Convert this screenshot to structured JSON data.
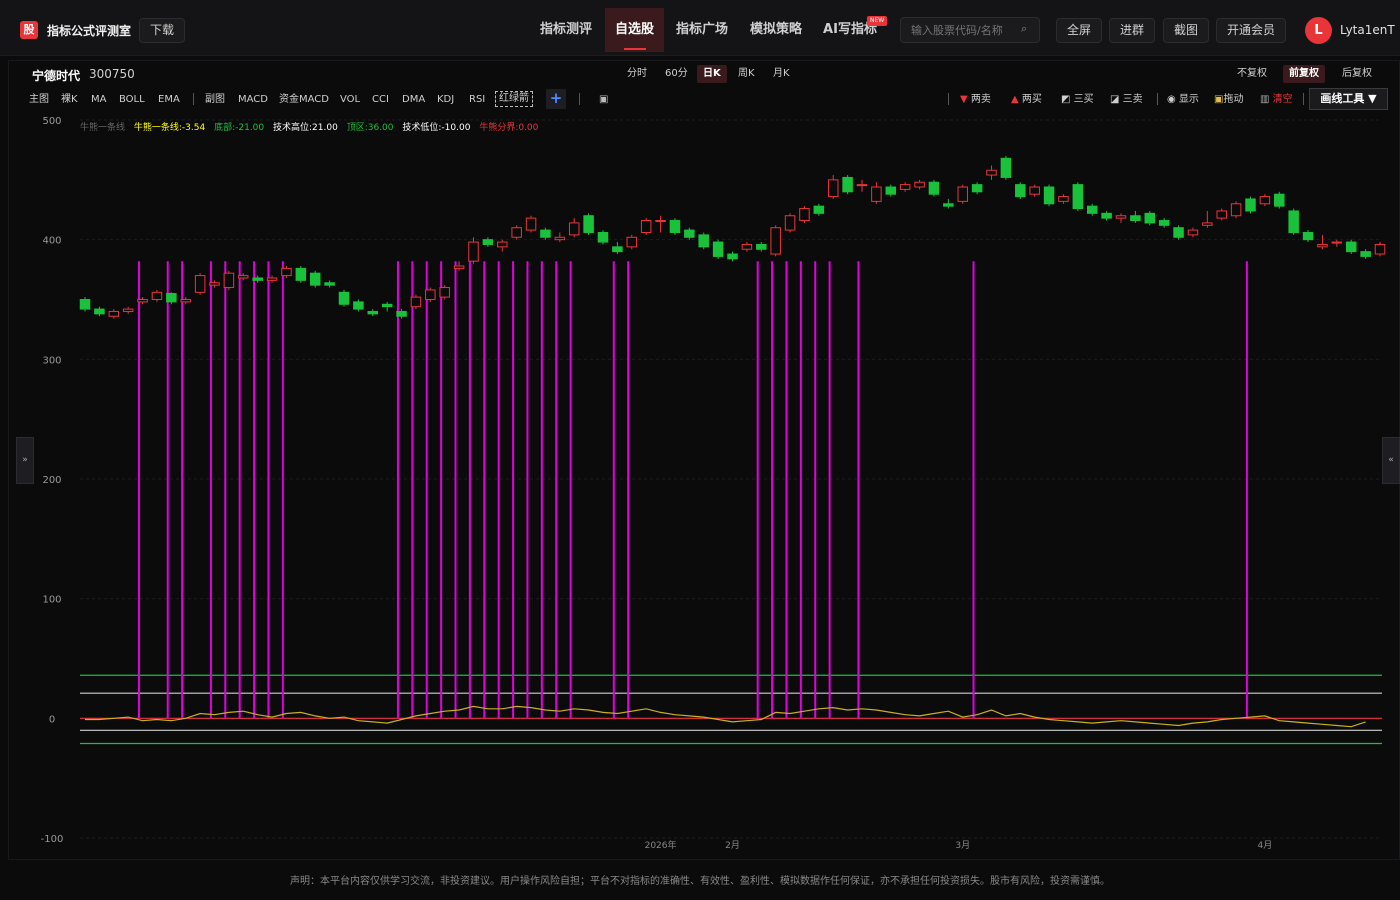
{
  "app": {
    "logo_char": "股",
    "title": "指标公式评测室",
    "download": "下载"
  },
  "nav": {
    "items": [
      "指标测评",
      "自选股",
      "指标广场",
      "模拟策略",
      "AI写指标"
    ],
    "active": "自选股",
    "new_badge": "NEW"
  },
  "search": {
    "placeholder": "输入股票代码/名称",
    "icon": "search-icon"
  },
  "top_buttons": [
    "全屏",
    "进群",
    "截图",
    "开通会员"
  ],
  "user": {
    "initial": "L",
    "name": "Lyta1enT"
  },
  "stock": {
    "name": "宁德时代",
    "code": "300750"
  },
  "periods": {
    "items": [
      "分时",
      "60分",
      "日K",
      "周K",
      "月K"
    ],
    "active": "日K"
  },
  "adjust": {
    "items": [
      "不复权",
      "前复权",
      "后复权"
    ],
    "active": "前复权"
  },
  "indicators": {
    "main_label": "主图",
    "main": [
      "裸K",
      "MA",
      "BOLL",
      "EMA"
    ],
    "sub_label": "副图",
    "sub": [
      "MACD",
      "资金MACD",
      "VOL",
      "CCI",
      "DMA",
      "KDJ",
      "RSI",
      "红绿箭"
    ],
    "selected": "红绿箭",
    "add": "+",
    "save_icon": "save-icon"
  },
  "tools": {
    "items": [
      {
        "icon": "▼",
        "label": "两卖",
        "color": "#e8353a"
      },
      {
        "icon": "▲",
        "label": "两买",
        "color": "#e8353a"
      },
      {
        "icon": "◩",
        "label": "三买",
        "color": "#cfcfcf"
      },
      {
        "icon": "◪",
        "label": "三卖",
        "color": "#cfcfcf"
      },
      {
        "icon": "◉",
        "label": "显示",
        "color": "#cfcfcf"
      },
      {
        "icon": "🔒",
        "label": "拖动",
        "color": "#cfcfcf"
      },
      {
        "icon": "🗑",
        "label": "清空",
        "color": "#e8353a"
      }
    ],
    "draw_tool": "画线工具 ▼"
  },
  "side_tabs": {
    "left": "»",
    "right": "«"
  },
  "legend": [
    {
      "text": "牛熊一条线",
      "color": "#666666"
    },
    {
      "text": "牛熊一条线:-3.54",
      "color": "#ffff00"
    },
    {
      "text": "底部:-21.00",
      "color": "#19c23a"
    },
    {
      "text": "技术高位:21.00",
      "color": "#ffffff"
    },
    {
      "text": "顶区:36.00",
      "color": "#19c23a"
    },
    {
      "text": "技术低位:-10.00",
      "color": "#ffffff"
    },
    {
      "text": "牛熊分界:0.00",
      "color": "#e8353a"
    }
  ],
  "chart_data": {
    "type": "candlestick",
    "y_ticks": [
      500,
      400,
      300,
      200,
      100,
      0,
      -100
    ],
    "ylim": [
      -100,
      500
    ],
    "x_labels": [
      {
        "index": 40,
        "text": "2026年"
      },
      {
        "index": 45,
        "text": "2月"
      },
      {
        "index": 61,
        "text": "3月"
      },
      {
        "index": 82,
        "text": "4月"
      }
    ],
    "colors": {
      "up": "#e8353a",
      "down": "#19c23a",
      "signal": "#e000e0",
      "line": "#c8b020"
    },
    "candles": [
      [
        350,
        342,
        352,
        340
      ],
      [
        342,
        338,
        344,
        336
      ],
      [
        336,
        340,
        342,
        334
      ],
      [
        340,
        342,
        344,
        338
      ],
      [
        348,
        350,
        352,
        346
      ],
      [
        350,
        356,
        358,
        348
      ],
      [
        355,
        348,
        356,
        346
      ],
      [
        348,
        350,
        352,
        346
      ],
      [
        356,
        370,
        372,
        354
      ],
      [
        362,
        364,
        366,
        360
      ],
      [
        360,
        372,
        374,
        358
      ],
      [
        368,
        370,
        372,
        366
      ],
      [
        368,
        366,
        370,
        364
      ],
      [
        366,
        368,
        370,
        364
      ],
      [
        370,
        376,
        378,
        368
      ],
      [
        376,
        366,
        378,
        364
      ],
      [
        372,
        362,
        374,
        360
      ],
      [
        364,
        362,
        366,
        360
      ],
      [
        356,
        346,
        358,
        344
      ],
      [
        348,
        342,
        350,
        340
      ],
      [
        340,
        338,
        342,
        336
      ],
      [
        346,
        344,
        348,
        340
      ],
      [
        340,
        336,
        342,
        334
      ],
      [
        344,
        352,
        354,
        342
      ],
      [
        350,
        358,
        360,
        348
      ],
      [
        352,
        360,
        362,
        350
      ],
      [
        376,
        378,
        382,
        374
      ],
      [
        382,
        398,
        402,
        380
      ],
      [
        400,
        396,
        402,
        394
      ],
      [
        394,
        398,
        400,
        390
      ],
      [
        402,
        410,
        412,
        400
      ],
      [
        408,
        418,
        420,
        406
      ],
      [
        408,
        402,
        410,
        400
      ],
      [
        400,
        402,
        406,
        398
      ],
      [
        404,
        414,
        418,
        402
      ],
      [
        420,
        406,
        422,
        404
      ],
      [
        406,
        398,
        408,
        396
      ],
      [
        394,
        390,
        398,
        388
      ],
      [
        394,
        402,
        404,
        392
      ],
      [
        406,
        416,
        418,
        404
      ],
      [
        416,
        416,
        420,
        406
      ],
      [
        416,
        406,
        418,
        404
      ],
      [
        408,
        402,
        410,
        400
      ],
      [
        404,
        394,
        406,
        392
      ],
      [
        398,
        386,
        400,
        384
      ],
      [
        388,
        384,
        390,
        382
      ],
      [
        392,
        396,
        398,
        390
      ],
      [
        396,
        392,
        398,
        390
      ],
      [
        388,
        410,
        412,
        386
      ],
      [
        408,
        420,
        422,
        406
      ],
      [
        416,
        426,
        428,
        414
      ],
      [
        428,
        422,
        430,
        420
      ],
      [
        436,
        450,
        454,
        434
      ],
      [
        452,
        440,
        454,
        438
      ],
      [
        446,
        446,
        450,
        440
      ],
      [
        432,
        444,
        448,
        430
      ],
      [
        444,
        438,
        446,
        436
      ],
      [
        442,
        446,
        448,
        440
      ],
      [
        444,
        448,
        450,
        442
      ],
      [
        448,
        438,
        450,
        436
      ],
      [
        430,
        428,
        434,
        426
      ],
      [
        432,
        444,
        446,
        430
      ],
      [
        446,
        440,
        448,
        438
      ],
      [
        454,
        458,
        462,
        450
      ],
      [
        468,
        452,
        470,
        450
      ],
      [
        446,
        436,
        448,
        434
      ],
      [
        438,
        444,
        446,
        436
      ],
      [
        444,
        430,
        446,
        428
      ],
      [
        432,
        436,
        438,
        430
      ],
      [
        446,
        426,
        448,
        424
      ],
      [
        428,
        422,
        430,
        420
      ],
      [
        422,
        418,
        424,
        416
      ],
      [
        418,
        420,
        422,
        414
      ],
      [
        420,
        416,
        424,
        414
      ],
      [
        422,
        414,
        424,
        412
      ],
      [
        416,
        412,
        418,
        410
      ],
      [
        410,
        402,
        412,
        400
      ],
      [
        404,
        408,
        410,
        402
      ],
      [
        412,
        414,
        424,
        410
      ],
      [
        418,
        424,
        426,
        416
      ],
      [
        420,
        430,
        432,
        418
      ],
      [
        434,
        424,
        436,
        422
      ],
      [
        430,
        436,
        438,
        428
      ],
      [
        438,
        428,
        440,
        426
      ],
      [
        424,
        406,
        426,
        404
      ],
      [
        406,
        400,
        408,
        398
      ],
      [
        394,
        396,
        404,
        392
      ],
      [
        398,
        398,
        400,
        394
      ],
      [
        398,
        390,
        400,
        388
      ],
      [
        390,
        386,
        392,
        384
      ],
      [
        388,
        396,
        398,
        386
      ]
    ],
    "signals": [
      4,
      6,
      7,
      9,
      10,
      11,
      12,
      13,
      14,
      22,
      23,
      24,
      25,
      26,
      27,
      28,
      29,
      30,
      31,
      32,
      33,
      34,
      37,
      38,
      47,
      48,
      49,
      50,
      51,
      52,
      54,
      62,
      81
    ],
    "signal_top": 382,
    "bull_bear_line": [
      -1,
      -1,
      0,
      1,
      -2,
      -1,
      -2,
      0,
      4,
      3,
      5,
      6,
      3,
      1,
      4,
      5,
      2,
      0,
      1,
      -2,
      -3,
      -4,
      -1,
      2,
      4,
      6,
      7,
      10,
      8,
      8,
      10,
      9,
      7,
      6,
      8,
      7,
      5,
      4,
      6,
      8,
      5,
      3,
      2,
      1,
      -1,
      -3,
      -2,
      -1,
      5,
      4,
      6,
      8,
      9,
      7,
      8,
      7,
      5,
      3,
      2,
      4,
      6,
      1,
      3,
      7,
      2,
      4,
      1,
      -1,
      -2,
      -3,
      -4,
      -3,
      -2,
      -3,
      -4,
      -5,
      -6,
      -4,
      -3,
      -1,
      0,
      1,
      2,
      -2,
      -3,
      -4,
      -5,
      -6,
      -7,
      -3
    ]
  },
  "disclaimer": "声明：本平台内容仅供学习交流，非投资建议。用户操作风险自担；平台不对指标的准确性、有效性、盈利性、模拟数据作任何保证，亦不承担任何投资损失。股市有风险，投资需谨慎。"
}
